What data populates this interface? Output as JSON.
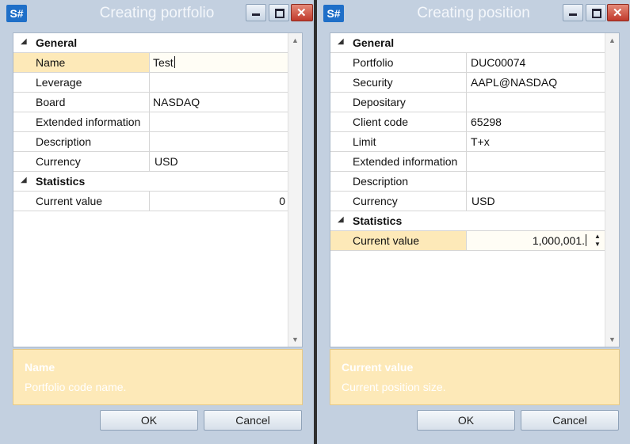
{
  "app_icon_text": "S#",
  "left": {
    "title": "Creating portfolio",
    "categories": {
      "general": "General",
      "statistics": "Statistics"
    },
    "general_rows": [
      {
        "name": "Name",
        "value": "Test"
      },
      {
        "name": "Leverage",
        "value": ""
      },
      {
        "name": "Board",
        "value": "NASDAQ"
      },
      {
        "name": "Extended information",
        "value": ""
      },
      {
        "name": "Description",
        "value": ""
      },
      {
        "name": "Currency",
        "value": "USD"
      }
    ],
    "statistics_rows": [
      {
        "name": "Current value",
        "value": "0"
      }
    ],
    "description": {
      "title": "Name",
      "text": "Portfolio code name."
    },
    "ok_label": "OK",
    "cancel_label": "Cancel"
  },
  "right": {
    "title": "Creating position",
    "categories": {
      "general": "General",
      "statistics": "Statistics"
    },
    "general_rows": [
      {
        "name": "Portfolio",
        "value": "DUC00074"
      },
      {
        "name": "Security",
        "value": "AAPL@NASDAQ"
      },
      {
        "name": "Depositary",
        "value": ""
      },
      {
        "name": "Client code",
        "value": "65298"
      },
      {
        "name": "Limit",
        "value": "T+x"
      },
      {
        "name": "Extended information",
        "value": ""
      },
      {
        "name": "Description",
        "value": ""
      },
      {
        "name": "Currency",
        "value": "USD"
      }
    ],
    "statistics_rows": [
      {
        "name": "Current value",
        "value": "1,000,001."
      }
    ],
    "description": {
      "title": "Current value",
      "text": "Current position size."
    },
    "ok_label": "OK",
    "cancel_label": "Cancel"
  },
  "icons": {
    "collapse": "collapse-triangle-icon",
    "minimize": "minimize-icon",
    "maximize": "maximize-icon",
    "close": "close-icon",
    "scroll_up": "scroll-up-icon",
    "scroll_down": "scroll-down-icon",
    "spin": "spin-updown-icon"
  },
  "colors": {
    "selected_row": "#fde9b8",
    "description_panel": "#fde9b8",
    "window_frame": "#c3d0e0",
    "close_button": "#c0392b",
    "app_icon": "#1f6fc8"
  }
}
